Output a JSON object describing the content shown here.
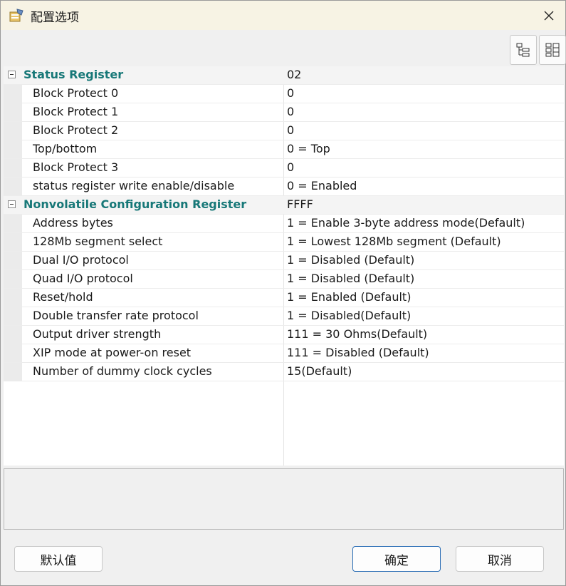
{
  "window": {
    "title": "配置选项"
  },
  "toolbar": {
    "icons": [
      "tree-view-icon",
      "grid-view-icon"
    ]
  },
  "properties": {
    "groups": [
      {
        "name": "Status Register",
        "value": "02",
        "rows": [
          {
            "name": "Block Protect 0",
            "value": "0"
          },
          {
            "name": "Block Protect 1",
            "value": "0"
          },
          {
            "name": "Block Protect 2",
            "value": "0"
          },
          {
            "name": "Top/bottom",
            "value": "0 = Top"
          },
          {
            "name": "Block Protect 3",
            "value": "0"
          },
          {
            "name": "status register write enable/disable",
            "value": "0 = Enabled"
          }
        ]
      },
      {
        "name": "Nonvolatile Configuration Register",
        "value": "FFFF",
        "rows": [
          {
            "name": "Address bytes",
            "value": "1 = Enable 3-byte address mode(Default)"
          },
          {
            "name": "128Mb segment select",
            "value": "1 = Lowest 128Mb segment (Default)"
          },
          {
            "name": "Dual I/O protocol",
            "value": "1 = Disabled (Default)"
          },
          {
            "name": "Quad I/O protocol",
            "value": "1 = Disabled (Default)"
          },
          {
            "name": "Reset/hold",
            "value": "1 = Enabled (Default)"
          },
          {
            "name": "Double transfer rate protocol",
            "value": "1 = Disabled(Default)"
          },
          {
            "name": "Output driver strength",
            "value": "111 = 30 Ohms(Default)"
          },
          {
            "name": "XIP mode at power-on reset",
            "value": "111 = Disabled (Default)"
          },
          {
            "name": "Number of dummy clock cycles",
            "value": "15(Default)"
          }
        ]
      }
    ]
  },
  "buttons": {
    "default": "默认值",
    "ok": "确定",
    "cancel": "取消"
  },
  "colors": {
    "category_text": "#177878",
    "titlebar": "#f7f3e4",
    "primary_border": "#2a6db5"
  }
}
